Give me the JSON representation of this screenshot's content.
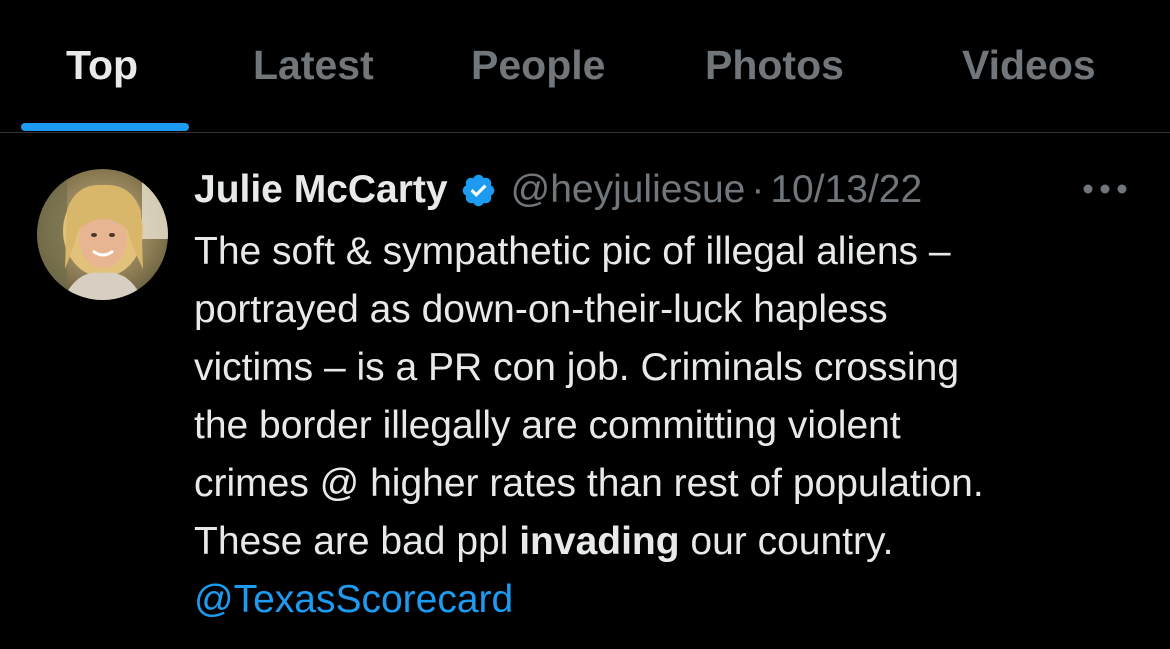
{
  "tabs": [
    {
      "label": "Top",
      "active": true
    },
    {
      "label": "Latest",
      "active": false
    },
    {
      "label": "People",
      "active": false
    },
    {
      "label": "Photos",
      "active": false
    },
    {
      "label": "Videos",
      "active": false
    }
  ],
  "tweet": {
    "author_name": "Julie McCarty",
    "verified": true,
    "handle": "@heyjuliesue",
    "separator": "·",
    "date": "10/13/22",
    "more_icon": "more-horizontal-icon",
    "text_lines": [
      "The soft & sympathetic pic of illegal aliens –",
      "portrayed as down-on-their-luck hapless",
      "victims – is a PR con job. Criminals crossing",
      "the border illegally are committing violent",
      "crimes @ higher rates than rest of population."
    ],
    "last_line": {
      "before": "These are bad ppl ",
      "bold": "invading",
      "after": " our country."
    },
    "mention": "@TexasScorecard"
  },
  "colors": {
    "background": "#000000",
    "text_primary": "#e7e9ea",
    "text_secondary": "#71767b",
    "accent": "#1d9bf0",
    "divider": "#2f3336"
  }
}
